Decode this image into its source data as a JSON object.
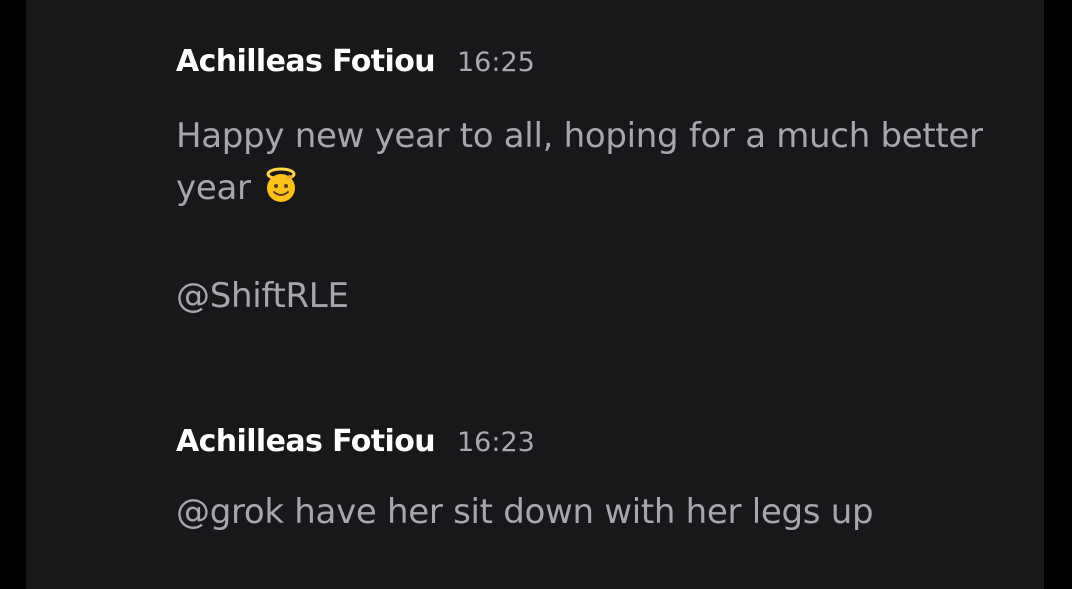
{
  "colors": {
    "background": "#000000",
    "panel": "#18181a",
    "author": "#ffffff",
    "timestamp": "#a9a9ad",
    "message_text": "#a6a6ab"
  },
  "messages": [
    {
      "author": "Achilleas Fotiou",
      "time": "16:25",
      "lines": [
        "Happy new year to all, hoping for a much better",
        "year"
      ],
      "emoji": "saluting-face-with-halo-icon",
      "mention": "@ShiftRLE"
    },
    {
      "author": "Achilleas Fotiou",
      "time": "16:23",
      "lines": [
        "@grok have her sit down with her legs up"
      ]
    }
  ]
}
